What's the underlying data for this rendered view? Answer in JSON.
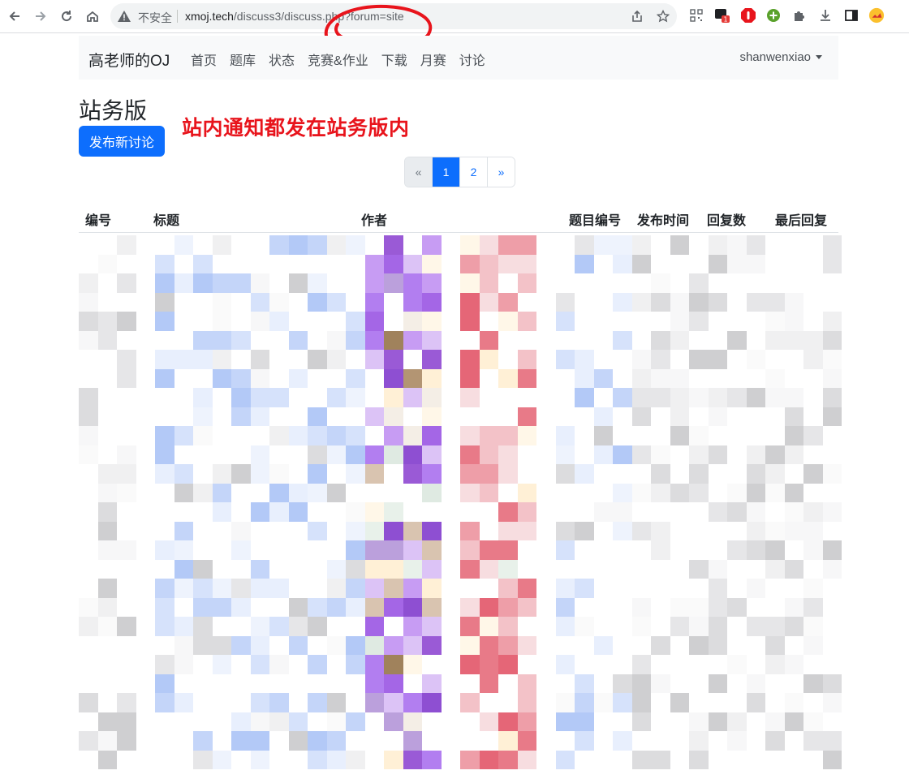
{
  "browser": {
    "insecure_label": "不安全",
    "url_host": "xmoj.tech",
    "url_path": "/discuss3/discuss.php?forum=site",
    "extension_badge": "1"
  },
  "navbar": {
    "brand": "高老师的OJ",
    "links": [
      "首页",
      "题库",
      "状态",
      "竞赛&作业",
      "下载",
      "月赛",
      "讨论"
    ],
    "user": "shanwenxiao"
  },
  "page": {
    "title": "站务版",
    "new_discussion_button": "发布新讨论",
    "annotation_text": "站内通知都发在站务版内"
  },
  "pagination": {
    "prev": "«",
    "pages": [
      "1",
      "2"
    ],
    "active_page": "1",
    "next": "»"
  },
  "table": {
    "headers": [
      "编号",
      "标题",
      "作者",
      "题目编号",
      "发布时间",
      "回复数",
      "最后回复"
    ]
  },
  "colors": {
    "primary": "#0d6efd",
    "annotation_red": "#e8141c",
    "navbar_bg": "#f8f9fa"
  },
  "icons": {
    "back": "arrow-left-icon",
    "forward": "arrow-right-icon",
    "reload": "reload-icon",
    "home": "home-icon",
    "warning": "warning-icon",
    "share": "share-icon",
    "bookmark": "star-icon",
    "qr": "qr-code-icon",
    "extensions": "puzzle-icon",
    "download": "download-icon",
    "sidepanel": "side-panel-icon",
    "profile": "avatar-icon"
  }
}
